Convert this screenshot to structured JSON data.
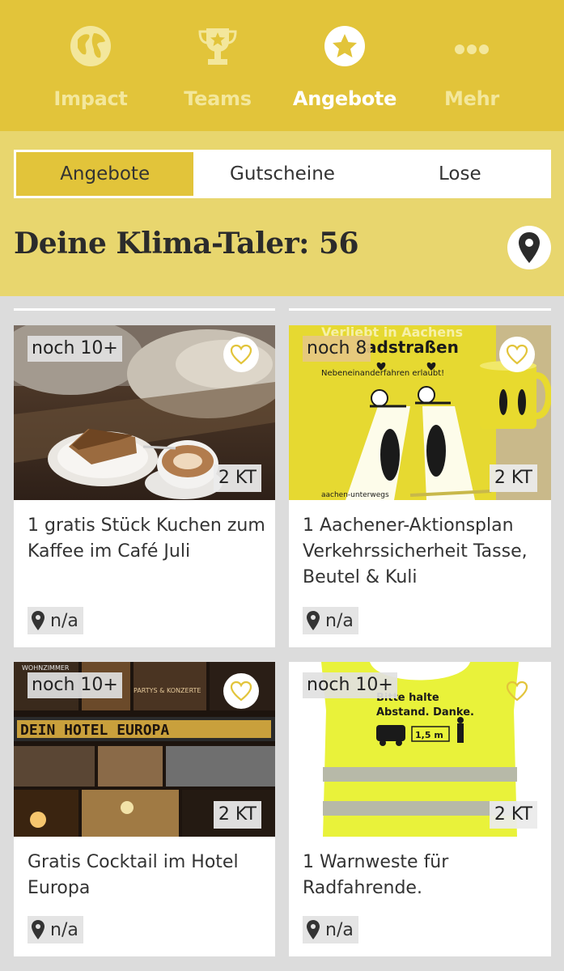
{
  "nav": {
    "items": [
      {
        "label": "Impact",
        "icon": "globe-icon"
      },
      {
        "label": "Teams",
        "icon": "trophy-icon"
      },
      {
        "label": "Angebote",
        "icon": "star-circle-icon",
        "active": true
      },
      {
        "label": "Mehr",
        "icon": "more-dots-icon"
      }
    ]
  },
  "tabs": [
    "Angebote",
    "Gutscheine",
    "Lose"
  ],
  "active_tab": "Angebote",
  "balance": "Deine Klima-Taler: 56",
  "offers": [
    {
      "remaining": "noch 10+",
      "price": "2 KT",
      "title": "1 gratis Stück Kuchen zum Kaffee im Café Juli",
      "location": "n/a",
      "image": "cake-and-coffee-photo"
    },
    {
      "remaining": "noch 8",
      "price": "2 KT",
      "title": "1 Aachener-Aktionsplan Verkehrssicherheit Tasse, Beutel & Kuli",
      "location": "n/a",
      "image": "yellow-bag-and-mug-photo",
      "image_text": {
        "bag_top": "Verliebt in Aachens",
        "bag_main": "adstraßen",
        "bag_sub": "Nebeneinanderfahren erlaubt!"
      }
    },
    {
      "remaining": "noch 10+",
      "price": "2 KT",
      "title": "Gratis Cocktail im Hotel Europa",
      "location": "n/a",
      "image": "hotel-europa-collage",
      "image_text": {
        "sign": "DEIN HOTEL EUROPA",
        "top": "WOHNZIMMER",
        "partys": "PARTYS & KONZERTE"
      }
    },
    {
      "remaining": "noch 10+",
      "price": "2 KT",
      "title": "1 Warnweste für Radfahrende.",
      "location": "n/a",
      "image": "safety-vest-photo",
      "image_text": {
        "line1": "Bitte halte",
        "line2": "Abstand. Danke.",
        "distance": "1,5 m"
      }
    }
  ],
  "colors": {
    "header": "#e2c43a",
    "subheader": "#e8d66e",
    "accent": "#e2c43a",
    "background": "#dcdcdc"
  }
}
